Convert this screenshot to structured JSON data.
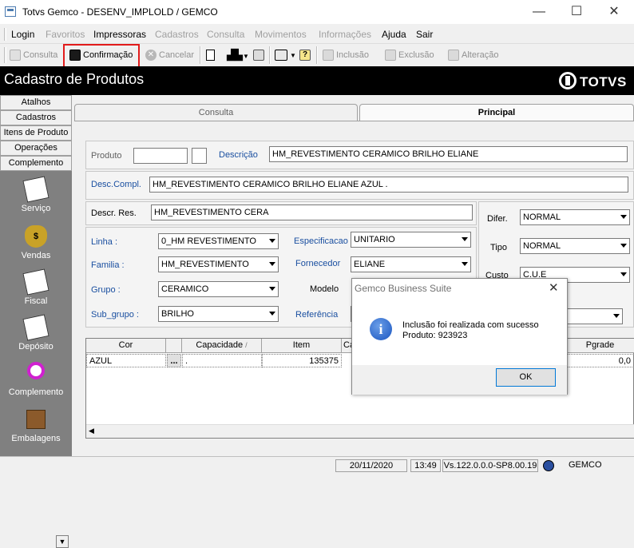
{
  "window": {
    "title": "Totvs Gemco - DESENV_IMPLOLD / GEMCO",
    "minimize": "—",
    "maximize": "☐",
    "close": "✕"
  },
  "menu": [
    "Login",
    "Favoritos",
    "Impressoras",
    "Cadastros",
    "Consulta",
    "Movimentos",
    "Informações",
    "Ajuda",
    "Sair"
  ],
  "toolbar": {
    "consulta": "Consulta",
    "confirmacao": "Confirmação",
    "cancelar": "Cancelar",
    "inclusao": "Inclusão",
    "exclusao": "Exclusão",
    "alteracao": "Alteração"
  },
  "header": {
    "title": "Cadastro de Produtos",
    "logo": "TOTVS"
  },
  "sidebar": {
    "tabs": [
      "Atalhos",
      "Cadastros",
      "Itens de Produto",
      "Operações",
      "Complemento"
    ],
    "items": [
      "Serviço",
      "Vendas",
      "Fiscal",
      "Depósito",
      "Complemento",
      "Embalagens"
    ]
  },
  "tabs": {
    "consulta": "Consulta",
    "principal": "Principal"
  },
  "form": {
    "produto_label": "Produto",
    "produto_value": "",
    "produto_digit": "",
    "descricao_label": "Descrição",
    "descricao_value": "HM_REVESTIMENTO CERAMICO BRILHO ELIANE",
    "desccompl_label": "Desc.Compl.",
    "desccompl_value": "HM_REVESTIMENTO CERAMICO BRILHO ELIANE AZUL .",
    "descres_label": "Descr. Res.",
    "descres_value": "HM_REVESTIMENTO CERA",
    "linha_label": "Linha :",
    "linha_value": "0_HM REVESTIMENTO",
    "familia_label": "Familia :",
    "familia_value": "HM_REVESTIMENTO",
    "grupo_label": "Grupo :",
    "grupo_value": "CERAMICO",
    "subgrupo_label": "Sub_grupo :",
    "subgrupo_value": "BRILHO",
    "especificacao_label": "Especificacao",
    "especificacao_value": "UNITARIO",
    "fornecedor_label": "Fornecedor",
    "fornecedor_value": "ELIANE",
    "modelo_label": "Modelo",
    "referencia_label": "Referência",
    "difer_label": "Difer.",
    "difer_value": "NORMAL",
    "tipo_label": "Tipo",
    "tipo_value": "NORMAL",
    "custo_label": "Custo",
    "custo_value": "C.U.E"
  },
  "grid": {
    "headers": {
      "cor": "Cor",
      "capacidade": "Capacidade",
      "item": "Item",
      "ca": "Ca",
      "pgrade": "Pgrade"
    },
    "row": {
      "cor": "AZUL",
      "btn": "...",
      "capacidade": ".",
      "item": "135375",
      "pgrade": "0,0"
    }
  },
  "status": {
    "date": "20/11/2020",
    "time": "13:49",
    "version": "Vs.122.0.0.0-SP8.00.19",
    "user": "GEMCO"
  },
  "dialog": {
    "title": "Gemco Business Suite",
    "close": "✕",
    "icon": "i",
    "line1": "Inclusão foi realizada com sucesso",
    "line2": "Produto: 923923",
    "ok": "OK"
  }
}
